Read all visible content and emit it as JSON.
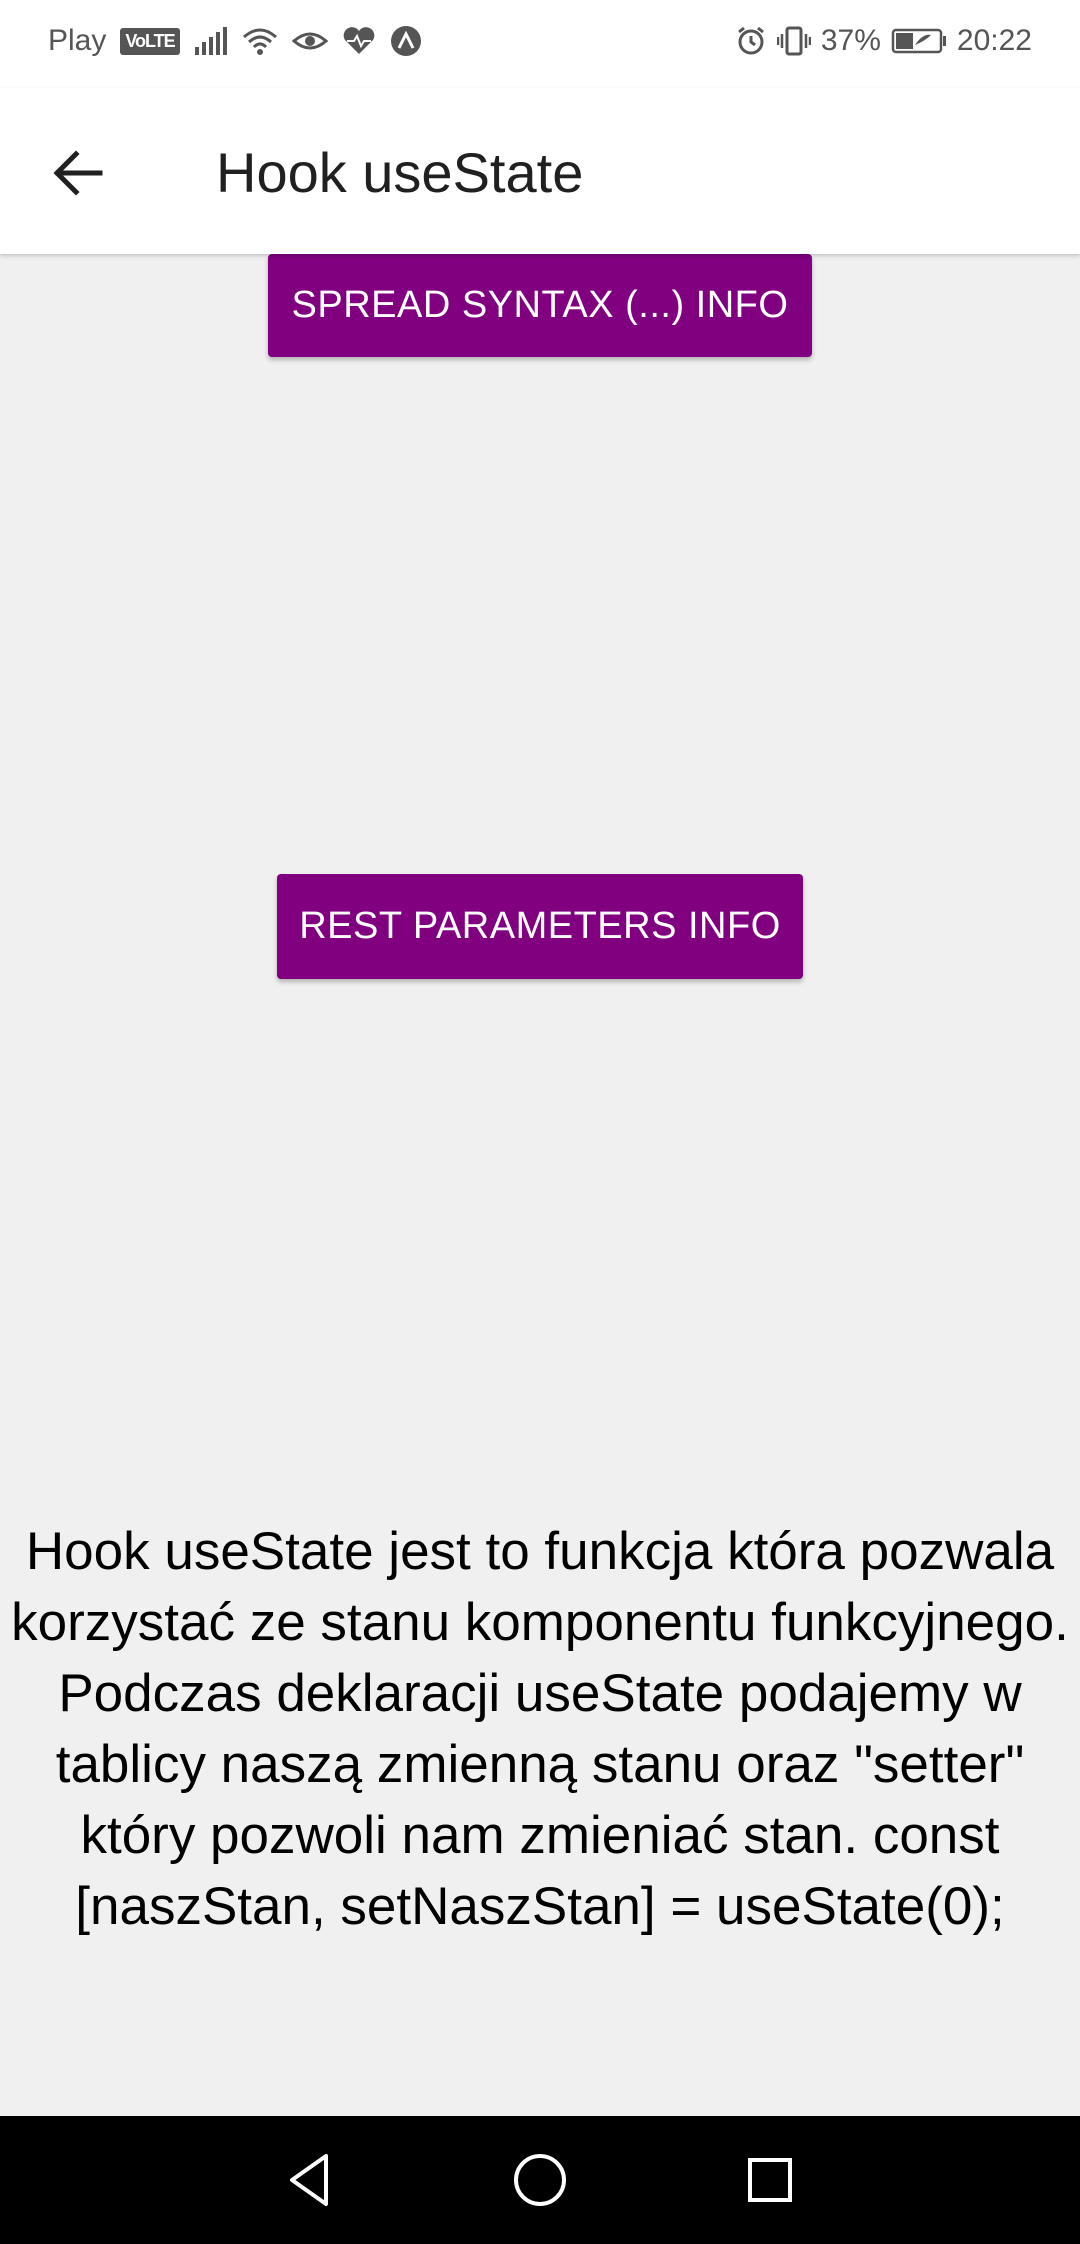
{
  "status_bar": {
    "carrier": "Play",
    "volte": "VoLTE",
    "battery": "37%",
    "time": "20:22"
  },
  "app_bar": {
    "title": "Hook useState"
  },
  "buttons": {
    "spread_label": "SPREAD SYNTAX (...) INFO",
    "rest_label": "REST PARAMETERS INFO"
  },
  "description": "Hook useState jest to funkcja która pozwala korzystać ze stanu komponentu funkcyjnego. Podczas deklaracji useState podajemy w tablicy naszą zmienną stanu oraz \"setter\" który pozwoli nam zmieniać stan. const [naszStan, setNaszStan] = useState(0);",
  "colors": {
    "accent": "#800080",
    "background": "#f0f0f0",
    "app_bar": "#ffffff",
    "nav_bar": "#000000"
  },
  "icons": {
    "back": "arrow-left-icon",
    "nav_back": "triangle-back-icon",
    "nav_home": "circle-home-icon",
    "nav_recent": "square-recents-icon"
  }
}
